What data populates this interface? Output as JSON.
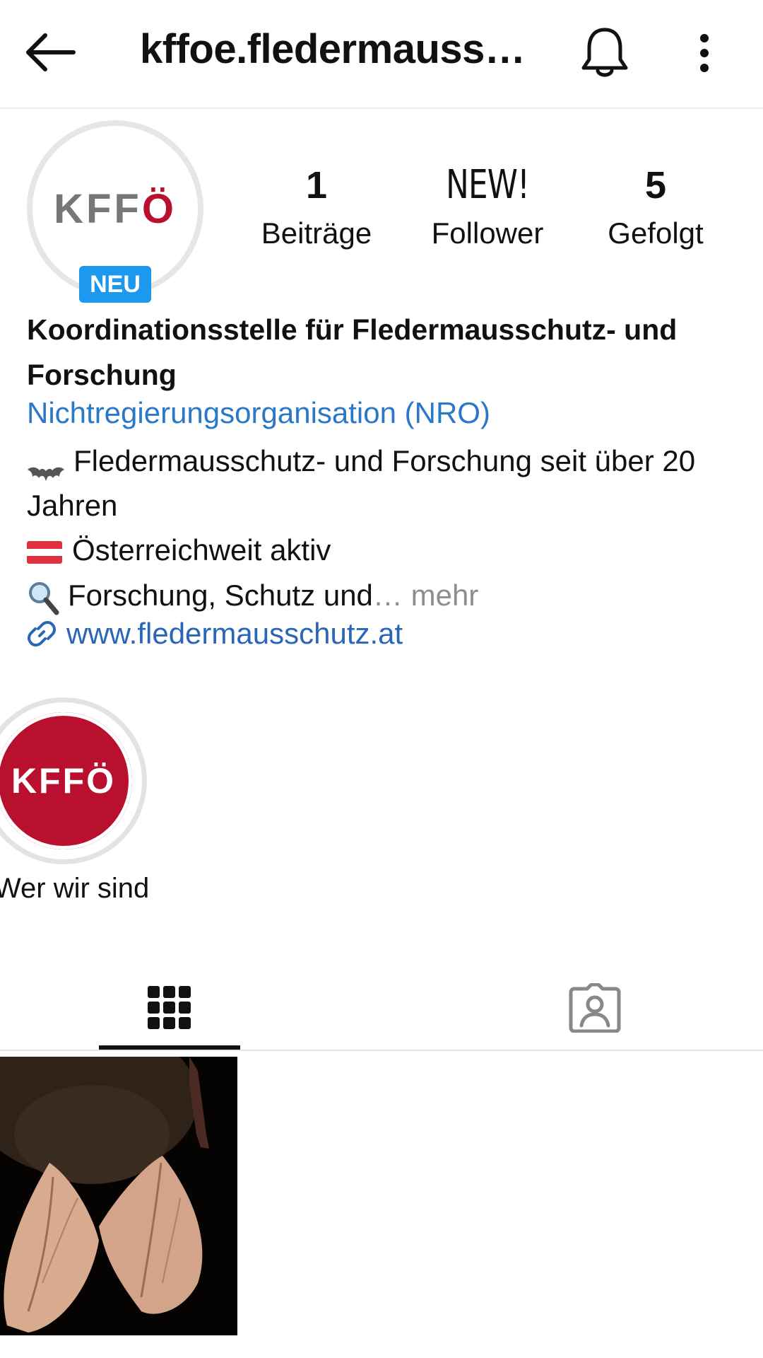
{
  "header": {
    "username": "kffoe.fledermauss…"
  },
  "profile": {
    "avatar_logo": "KFFÖ",
    "new_badge": "NEU",
    "stats": [
      {
        "value": "1",
        "label": "Beiträge"
      },
      {
        "value": "NEW!",
        "label": "Follower"
      },
      {
        "value": "5",
        "label": "Gefolgt"
      }
    ],
    "name": "Koordinationsstelle für Fledermausschutz- und Forschung",
    "category": "Nichtregierungsorganisation (NRO)",
    "bio_line1": "Fledermausschutz- und Forschung seit über 20 Jahren",
    "bio_line2": "Österreichweit aktiv",
    "bio_line3": "Forschung, Schutz und",
    "ellipsis": "…",
    "more_label": "mehr",
    "website": "www.fledermausschutz.at"
  },
  "highlights": [
    {
      "label": "Wer wir sind",
      "logo": "KFFÖ"
    }
  ],
  "colors": {
    "brand_red": "#b8102e",
    "link_blue": "#2a66b8",
    "badge_blue": "#1d98ef"
  }
}
